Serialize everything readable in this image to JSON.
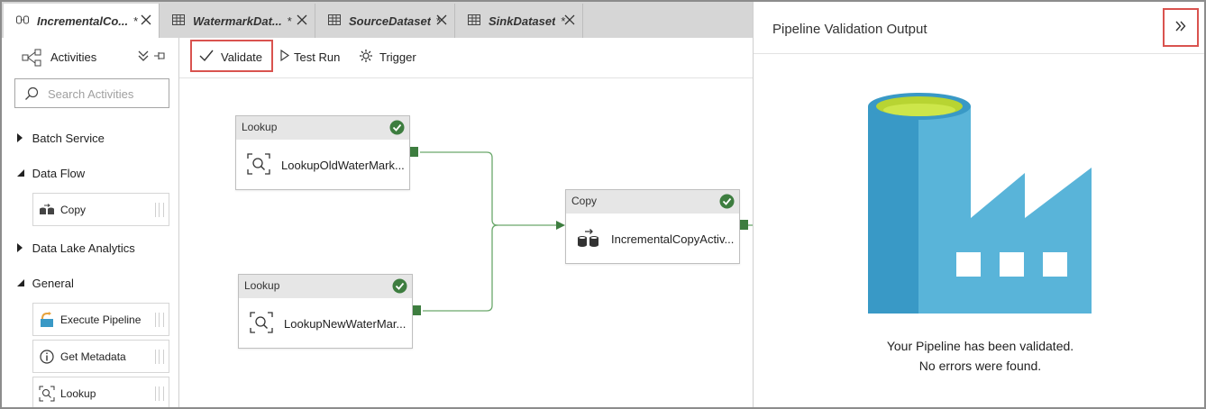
{
  "tabs": [
    {
      "label": "IncrementalCo...",
      "modified": "*",
      "icon": "pipeline-icon",
      "active": true
    },
    {
      "label": "WatermarkDat...",
      "modified": "*",
      "icon": "table-icon",
      "active": false
    },
    {
      "label": "SourceDataset",
      "modified": "*",
      "icon": "table-icon",
      "active": false
    },
    {
      "label": "SinkDataset",
      "modified": "*",
      "icon": "table-icon",
      "active": false
    }
  ],
  "toolbar": {
    "validate_label": "Validate",
    "test_run_label": "Test Run",
    "trigger_label": "Trigger"
  },
  "sidebar": {
    "title": "Activities",
    "search_placeholder": "Search Activities",
    "categories": [
      {
        "label": "Batch Service",
        "expanded": false
      },
      {
        "label": "Data Flow",
        "expanded": true,
        "items": [
          {
            "label": "Copy",
            "icon": "copy-icon"
          }
        ]
      },
      {
        "label": "Data Lake Analytics",
        "expanded": false
      },
      {
        "label": "General",
        "expanded": true,
        "items": [
          {
            "label": "Execute Pipeline",
            "icon": "execute-pipeline-icon"
          },
          {
            "label": "Get Metadata",
            "icon": "info-icon"
          },
          {
            "label": "Lookup",
            "icon": "lookup-icon"
          }
        ]
      }
    ]
  },
  "canvas": {
    "nodes": [
      {
        "type": "Lookup",
        "name": "LookupOldWaterMark...",
        "status": "valid"
      },
      {
        "type": "Lookup",
        "name": "LookupNewWaterMar...",
        "status": "valid"
      },
      {
        "type": "Copy",
        "name": "IncrementalCopyActiv...",
        "status": "valid"
      }
    ]
  },
  "validation_panel": {
    "title": "Pipeline Validation Output",
    "message_line1": "Your Pipeline has been validated.",
    "message_line2": "No errors were found."
  },
  "colors": {
    "highlight_border": "#d9534f",
    "success_green": "#3d7d3f",
    "factory_blue_light": "#59b4d9",
    "factory_blue_dark": "#3999c6",
    "factory_green": "#b8d432"
  }
}
